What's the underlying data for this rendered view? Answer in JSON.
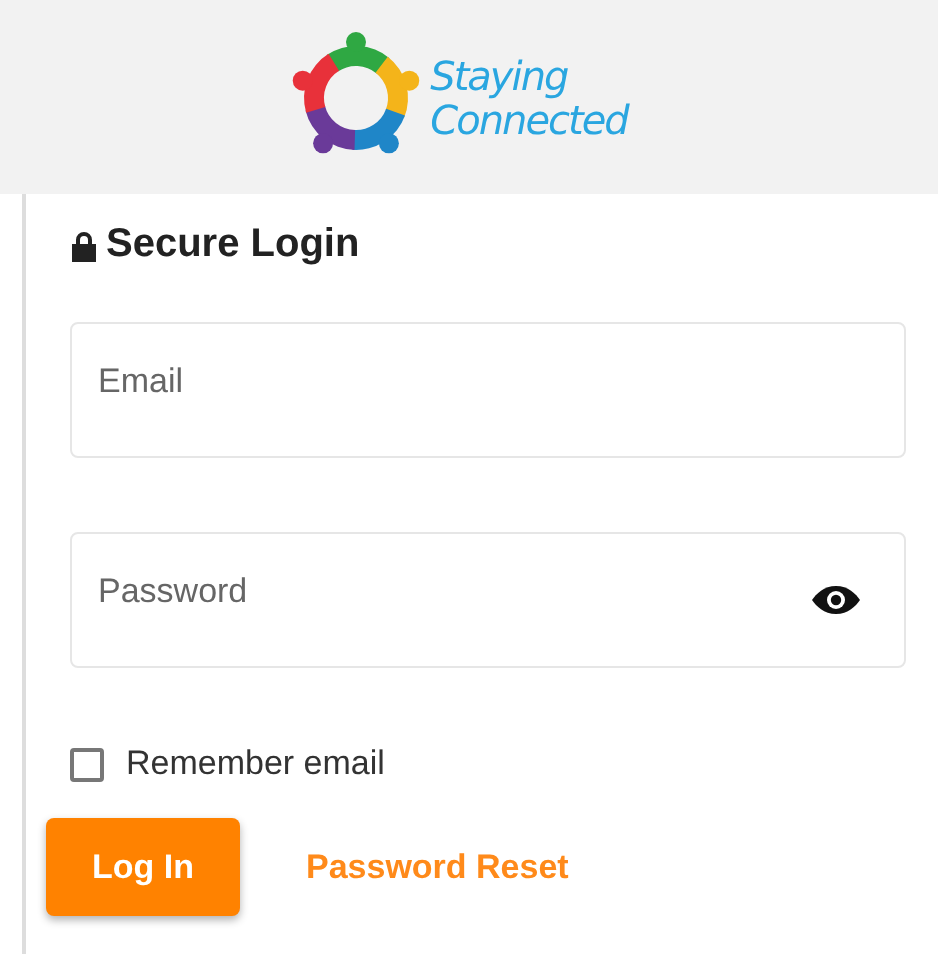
{
  "logo": {
    "lines": [
      "Staying",
      "Connected"
    ]
  },
  "heading": "Secure Login",
  "fields": [
    {
      "kind": "text",
      "placeholder": "Email"
    },
    {
      "kind": "password",
      "placeholder": "Password"
    }
  ],
  "remember": {
    "label": "Remember email",
    "checked": false
  },
  "login_button": "Log In",
  "reset_link": "Password Reset"
}
